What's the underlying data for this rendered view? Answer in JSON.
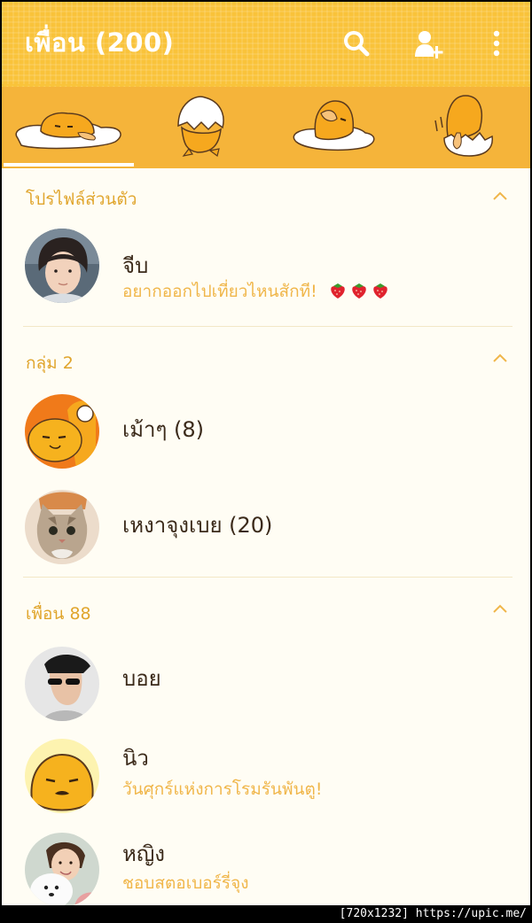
{
  "header": {
    "title": "เพื่อน (200)",
    "search_icon": "search-icon",
    "add_friend_icon": "add-friend-icon",
    "more_icon": "more-vertical-icon"
  },
  "tabs": [
    {
      "icon": "gudetama-lying-icon",
      "selected": true
    },
    {
      "icon": "gudetama-eggshell-icon",
      "selected": false
    },
    {
      "icon": "gudetama-facepalm-icon",
      "selected": false
    },
    {
      "icon": "gudetama-hatching-icon",
      "selected": false
    }
  ],
  "sections": {
    "profile": {
      "title": "โปรไฟล์ส่วนตัว",
      "rows": [
        {
          "name": "จีบ",
          "status": "อยากออกไปเที่ยวไหนสักที!"
        }
      ]
    },
    "groups": {
      "title": "กลุ่ม 2",
      "rows": [
        {
          "name": "เม้าๆ (8)"
        },
        {
          "name": "เหงาจุงเบย (20)"
        }
      ]
    },
    "friends": {
      "title": "เพื่อน 88",
      "rows": [
        {
          "name": "บอย"
        },
        {
          "name": "นิว",
          "status": "วันศุกร์แห่งการโรมรันพันตู!"
        },
        {
          "name": "หญิง",
          "status": "ชอบสตอเบอร์รี่จุง"
        }
      ]
    }
  },
  "colors": {
    "header": "#f9c33a",
    "tabbar": "#f5b43a",
    "accent_text": "#e0a52c",
    "status_text": "#f0b64a",
    "background": "#fffdf4"
  },
  "watermark": "[720x1232] https://upic.me/"
}
